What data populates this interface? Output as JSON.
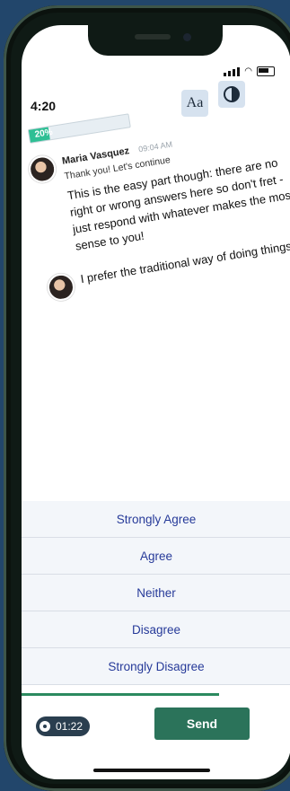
{
  "status": {
    "time": "4:20"
  },
  "toolbar": {
    "font_button": "Aa"
  },
  "progress": {
    "label": "20%",
    "value": 0.2
  },
  "chat": {
    "messages": [
      {
        "author": "Maria Vasquez",
        "time": "09:04 AM",
        "subtext": "Thank you! Let's continue",
        "text": "This is the easy part though: there are no right or wrong answers here so don't fret - just respond with whatever makes the most sense to you!"
      },
      {
        "text": "I prefer the traditional way of doing things:"
      }
    ]
  },
  "options": [
    "Strongly Agree",
    "Agree",
    "Neither",
    "Disagree",
    "Strongly Disagree"
  ],
  "footer": {
    "timer": "01:22",
    "send_label": "Send"
  },
  "icons": [
    "signal-icon",
    "wifi-icon",
    "battery-icon",
    "contrast-icon",
    "timer-icon"
  ],
  "colors": {
    "accent": "#2fbf94",
    "send": "#2b735a",
    "options_text": "#263a99",
    "background": "#22466b"
  }
}
